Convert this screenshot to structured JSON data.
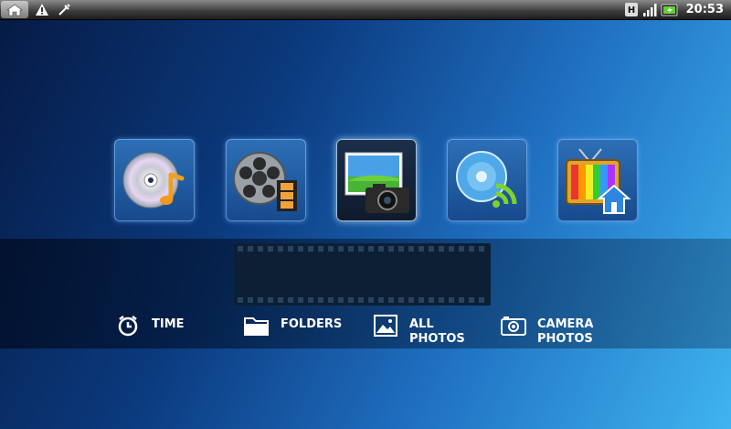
{
  "status_bar": {
    "clock": "20:53",
    "left_icons": [
      "home-icon",
      "warning-icon",
      "usb-debug-icon"
    ],
    "right_icons": [
      "hsdpa-icon",
      "signal-icon",
      "battery-icon"
    ]
  },
  "tiles": [
    {
      "name": "music",
      "icon": "music-disc-icon"
    },
    {
      "name": "videos",
      "icon": "film-reel-icon"
    },
    {
      "name": "photos",
      "icon": "photos-camera-icon",
      "selected": true
    },
    {
      "name": "online",
      "icon": "online-disc-icon"
    },
    {
      "name": "tv",
      "icon": "tv-home-icon"
    }
  ],
  "sort_options": [
    {
      "label": "TIME",
      "icon": "clock-icon"
    },
    {
      "label": "FOLDERS",
      "icon": "folder-icon"
    },
    {
      "label": "ALL\nPHOTOS",
      "line1": "ALL",
      "line2": "PHOTOS",
      "icon": "image-icon"
    },
    {
      "label": "CAMERA\nPHOTOS",
      "line1": "CAMERA",
      "line2": "PHOTOS",
      "icon": "camera-icon"
    }
  ]
}
